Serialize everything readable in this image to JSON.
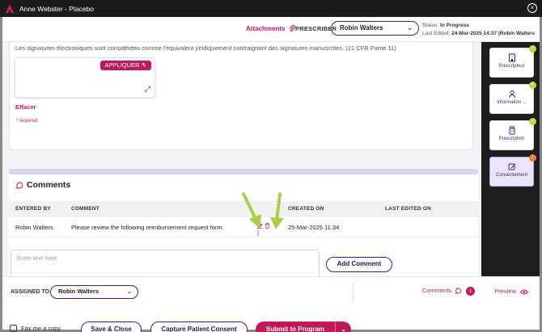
{
  "window": {
    "title": "Anne Webster - Placebo"
  },
  "header": {
    "attachments_label": "Attachments",
    "prescriber_label": "PRESCRIBER",
    "prescriber_value": "Robin  Walters",
    "status_label": "Status:",
    "status_value": "In Progress",
    "last_edited_label": "Last Edited:",
    "last_edited_value": "24-Mar-2025 14:37 |Robin Walters"
  },
  "signature": {
    "legal_text": "Les signatures électroniques sont considérées comme l'équivalent juridiquement contraignant des signatures manuscrites. (21 CFR Partie 11)",
    "apply_label": "APPLIQUER",
    "clear_label": "Effacer",
    "required_note": "* required"
  },
  "comments": {
    "title": "Comments",
    "columns": [
      "ENTERED BY",
      "COMMENT",
      "CREATED ON",
      "LAST EDITED ON"
    ],
    "rows": [
      {
        "entered_by": "Robin Walters",
        "comment": "Please review the following reimbursement request form.",
        "created_on": "25-Mar-2025 11:34",
        "last_edited_on": ""
      }
    ],
    "action_separator": "|",
    "input_placeholder": "Enter text here",
    "add_button": "Add Comment"
  },
  "sidebar": {
    "steps": [
      {
        "label": "Prescripteur",
        "icon": "building-icon",
        "status": "complete"
      },
      {
        "label": "Information ...",
        "icon": "person-icon",
        "status": "complete"
      },
      {
        "label": "Prescription",
        "icon": "prescription-icon",
        "status": "complete"
      },
      {
        "label": "Consentement",
        "icon": "edit-icon",
        "status": "active",
        "badge": "!"
      }
    ]
  },
  "footer": {
    "assigned_label": "ASSIGNED TO",
    "assigned_value": "Robin  Walters",
    "comments_link": "Comments",
    "comments_count": "1",
    "preview_link": "Preview",
    "fax_label": "Fax me a copy",
    "save_close": "Save & Close",
    "capture_consent": "Capture Patient Consent",
    "submit": "Submit to Program"
  },
  "colors": {
    "accent": "#c2185b",
    "brand": "#4a1f7a",
    "check": "#c0d54a",
    "arrow": "#a9d147"
  }
}
